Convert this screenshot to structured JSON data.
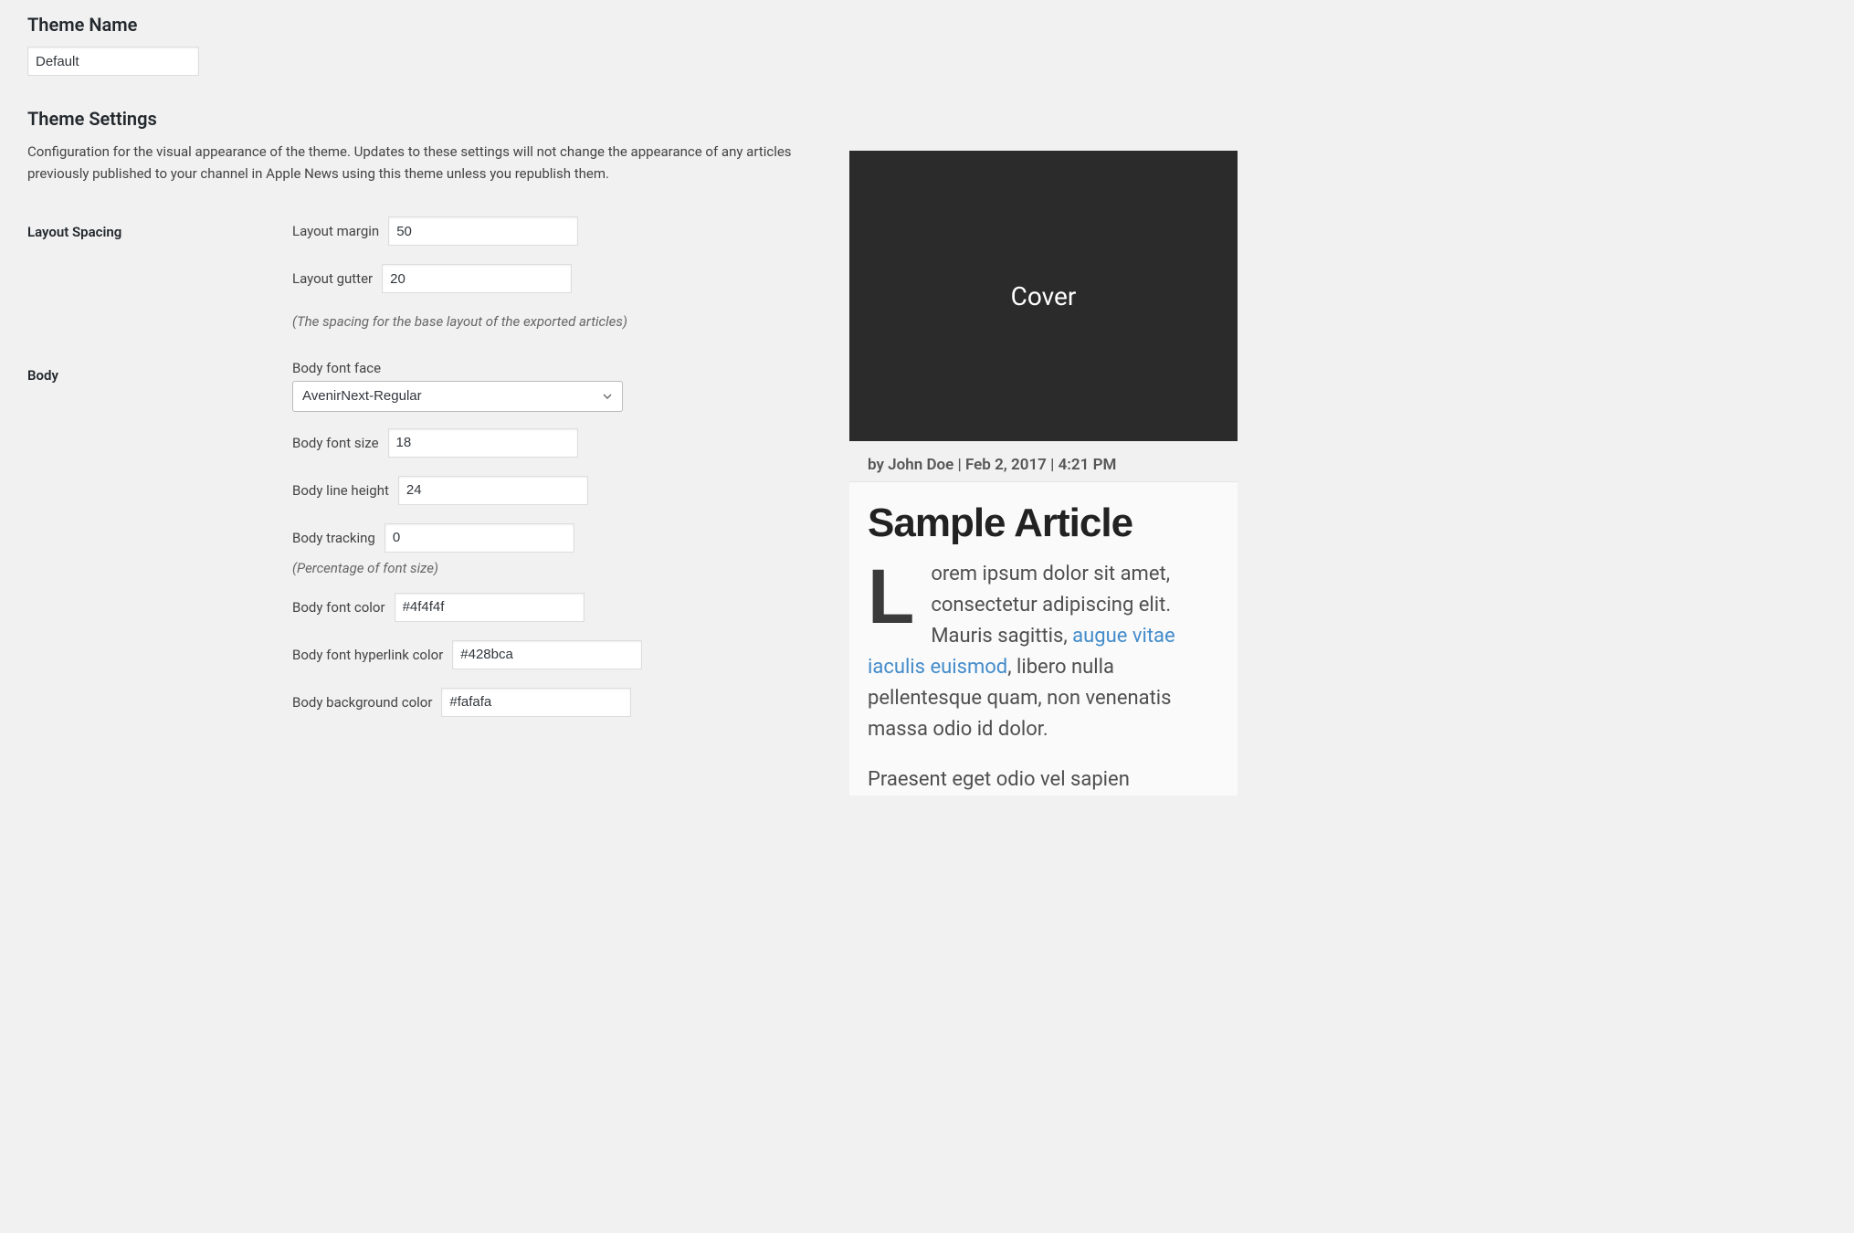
{
  "themeName": {
    "label": "Theme Name",
    "value": "Default"
  },
  "settings": {
    "heading": "Theme Settings",
    "description": "Configuration for the visual appearance of the theme. Updates to these settings will not change the appearance of any articles previously published to your channel in Apple News using this theme unless you republish them."
  },
  "layout": {
    "sectionLabel": "Layout Spacing",
    "marginLabel": "Layout margin",
    "marginValue": "50",
    "gutterLabel": "Layout gutter",
    "gutterValue": "20",
    "note": "(The spacing for the base layout of the exported articles)"
  },
  "body": {
    "sectionLabel": "Body",
    "fontFaceLabel": "Body font face",
    "fontFaceValue": "AvenirNext-Regular",
    "fontSizeLabel": "Body font size",
    "fontSizeValue": "18",
    "lineHeightLabel": "Body line height",
    "lineHeightValue": "24",
    "trackingLabel": "Body tracking",
    "trackingValue": "0",
    "trackingNote": "(Percentage of font size)",
    "fontColorLabel": "Body font color",
    "fontColorValue": "#4f4f4f",
    "hyperlinkColorLabel": "Body font hyperlink color",
    "hyperlinkColorValue": "#428bca",
    "bgColorLabel": "Body background color",
    "bgColorValue": "#fafafa"
  },
  "preview": {
    "coverText": "Cover",
    "meta": "by John Doe | Feb 2, 2017 | 4:21 PM",
    "title": "Sample Article",
    "p1_a": "Lorem ipsum dolor sit amet, consectetur adipiscing elit. Mauris sagittis, ",
    "p1_link": "augue vitae iaculis euismod",
    "p1_b": ", libero nulla pellentesque quam, non venenatis massa odio id dolor.",
    "p2": "Praesent eget odio vel sapien"
  }
}
